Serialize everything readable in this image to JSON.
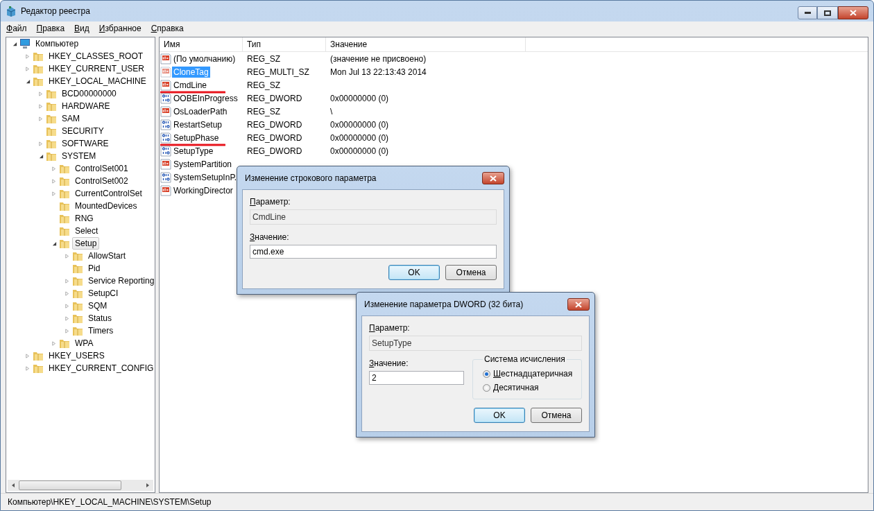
{
  "window": {
    "title": "Редактор реестра"
  },
  "menu": [
    {
      "label": "Файл"
    },
    {
      "label": "Правка"
    },
    {
      "label": "Вид"
    },
    {
      "label": "Избранное"
    },
    {
      "label": "Справка"
    }
  ],
  "tree": [
    {
      "label": "Компьютер",
      "kind": "computer",
      "expanded": true,
      "selected": false,
      "children": [
        {
          "label": "HKEY_CLASSES_ROOT",
          "kind": "folder",
          "expanded": false,
          "selected": false
        },
        {
          "label": "HKEY_CURRENT_USER",
          "kind": "folder",
          "expanded": false,
          "selected": false
        },
        {
          "label": "HKEY_LOCAL_MACHINE",
          "kind": "folder",
          "expanded": true,
          "selected": false,
          "children": [
            {
              "label": "BCD00000000",
              "kind": "folder",
              "expanded": false,
              "selected": false
            },
            {
              "label": "HARDWARE",
              "kind": "folder",
              "expanded": false,
              "selected": false
            },
            {
              "label": "SAM",
              "kind": "folder",
              "expanded": false,
              "selected": false
            },
            {
              "label": "SECURITY",
              "kind": "folder",
              "selected": false
            },
            {
              "label": "SOFTWARE",
              "kind": "folder",
              "expanded": false,
              "selected": false
            },
            {
              "label": "SYSTEM",
              "kind": "folder",
              "expanded": true,
              "selected": false,
              "children": [
                {
                  "label": "ControlSet001",
                  "kind": "folder",
                  "expanded": false,
                  "selected": false
                },
                {
                  "label": "ControlSet002",
                  "kind": "folder",
                  "expanded": false,
                  "selected": false
                },
                {
                  "label": "CurrentControlSet",
                  "kind": "folder",
                  "expanded": false,
                  "selected": false
                },
                {
                  "label": "MountedDevices",
                  "kind": "folder",
                  "selected": false
                },
                {
                  "label": "RNG",
                  "kind": "folder",
                  "selected": false
                },
                {
                  "label": "Select",
                  "kind": "folder",
                  "selected": false
                },
                {
                  "label": "Setup",
                  "kind": "folder",
                  "expanded": true,
                  "selected": true,
                  "children": [
                    {
                      "label": "AllowStart",
                      "kind": "folder",
                      "expanded": false,
                      "selected": false
                    },
                    {
                      "label": "Pid",
                      "kind": "folder",
                      "selected": false
                    },
                    {
                      "label": "Service Reporting",
                      "kind": "folder",
                      "expanded": false,
                      "selected": false
                    },
                    {
                      "label": "SetupCI",
                      "kind": "folder",
                      "expanded": false,
                      "selected": false
                    },
                    {
                      "label": "SQM",
                      "kind": "folder",
                      "expanded": false,
                      "selected": false
                    },
                    {
                      "label": "Status",
                      "kind": "folder",
                      "expanded": false,
                      "selected": false
                    },
                    {
                      "label": "Timers",
                      "kind": "folder",
                      "expanded": false,
                      "selected": false
                    }
                  ]
                },
                {
                  "label": "WPA",
                  "kind": "folder",
                  "expanded": false,
                  "selected": false
                }
              ]
            }
          ]
        },
        {
          "label": "HKEY_USERS",
          "kind": "folder",
          "expanded": false,
          "selected": false
        },
        {
          "label": "HKEY_CURRENT_CONFIG",
          "kind": "folder",
          "expanded": false,
          "selected": false
        }
      ]
    }
  ],
  "list": {
    "columns": [
      "Имя",
      "Тип",
      "Значение"
    ],
    "rows": [
      {
        "name": "(По умолчанию)",
        "kind": "string",
        "type": "REG_SZ",
        "value": "(значение не присвоено)",
        "selected": false,
        "underlined": false
      },
      {
        "name": "CloneTag",
        "kind": "string",
        "type": "REG_MULTI_SZ",
        "value": "Mon Jul 13 22:13:43 2014",
        "selected": true,
        "underlined": false
      },
      {
        "name": "CmdLine",
        "kind": "string",
        "type": "REG_SZ",
        "selected": false,
        "underlined": true
      },
      {
        "name": "OOBEInProgress",
        "kind": "dword",
        "type": "REG_DWORD",
        "value": "0x00000000 (0)",
        "selected": false,
        "underlined": false
      },
      {
        "name": "OsLoaderPath",
        "kind": "string",
        "type": "REG_SZ",
        "value": "\\",
        "selected": false,
        "underlined": false
      },
      {
        "name": "RestartSetup",
        "kind": "dword",
        "type": "REG_DWORD",
        "value": "0x00000000 (0)",
        "selected": false,
        "underlined": false
      },
      {
        "name": "SetupPhase",
        "kind": "dword",
        "type": "REG_DWORD",
        "value": "0x00000000 (0)",
        "selected": false,
        "underlined": true
      },
      {
        "name": "SetupType",
        "kind": "dword",
        "type": "REG_DWORD",
        "value": "0x00000000 (0)",
        "selected": false,
        "underlined": false
      },
      {
        "name": "SystemPartition",
        "kind": "string",
        "selected": false,
        "underlined": false
      },
      {
        "name": "SystemSetupInP.",
        "kind": "dword",
        "selected": false,
        "underlined": false
      },
      {
        "name": "WorkingDirector",
        "kind": "string",
        "selected": false,
        "underlined": false
      }
    ]
  },
  "status_bar": "Компьютер\\HKEY_LOCAL_MACHINE\\SYSTEM\\Setup",
  "string_dialog": {
    "title": "Изменение строкового параметра",
    "param_label": "Параметр:",
    "param": "CmdLine",
    "value_label": "Значение:",
    "value": "cmd.exe",
    "ok": "OK",
    "cancel": "Отмена"
  },
  "dword_dialog": {
    "title": "Изменение параметра DWORD (32 бита)",
    "param_label": "Параметр:",
    "param": "SetupType",
    "value_label": "Значение:",
    "value": "2",
    "base_label": "Система исчисления",
    "bases": [
      {
        "label": "Шестнадцатеричная",
        "selected": true
      },
      {
        "label": "Десятичная",
        "selected": false
      }
    ],
    "ok": "OK",
    "cancel": "Отмена"
  }
}
